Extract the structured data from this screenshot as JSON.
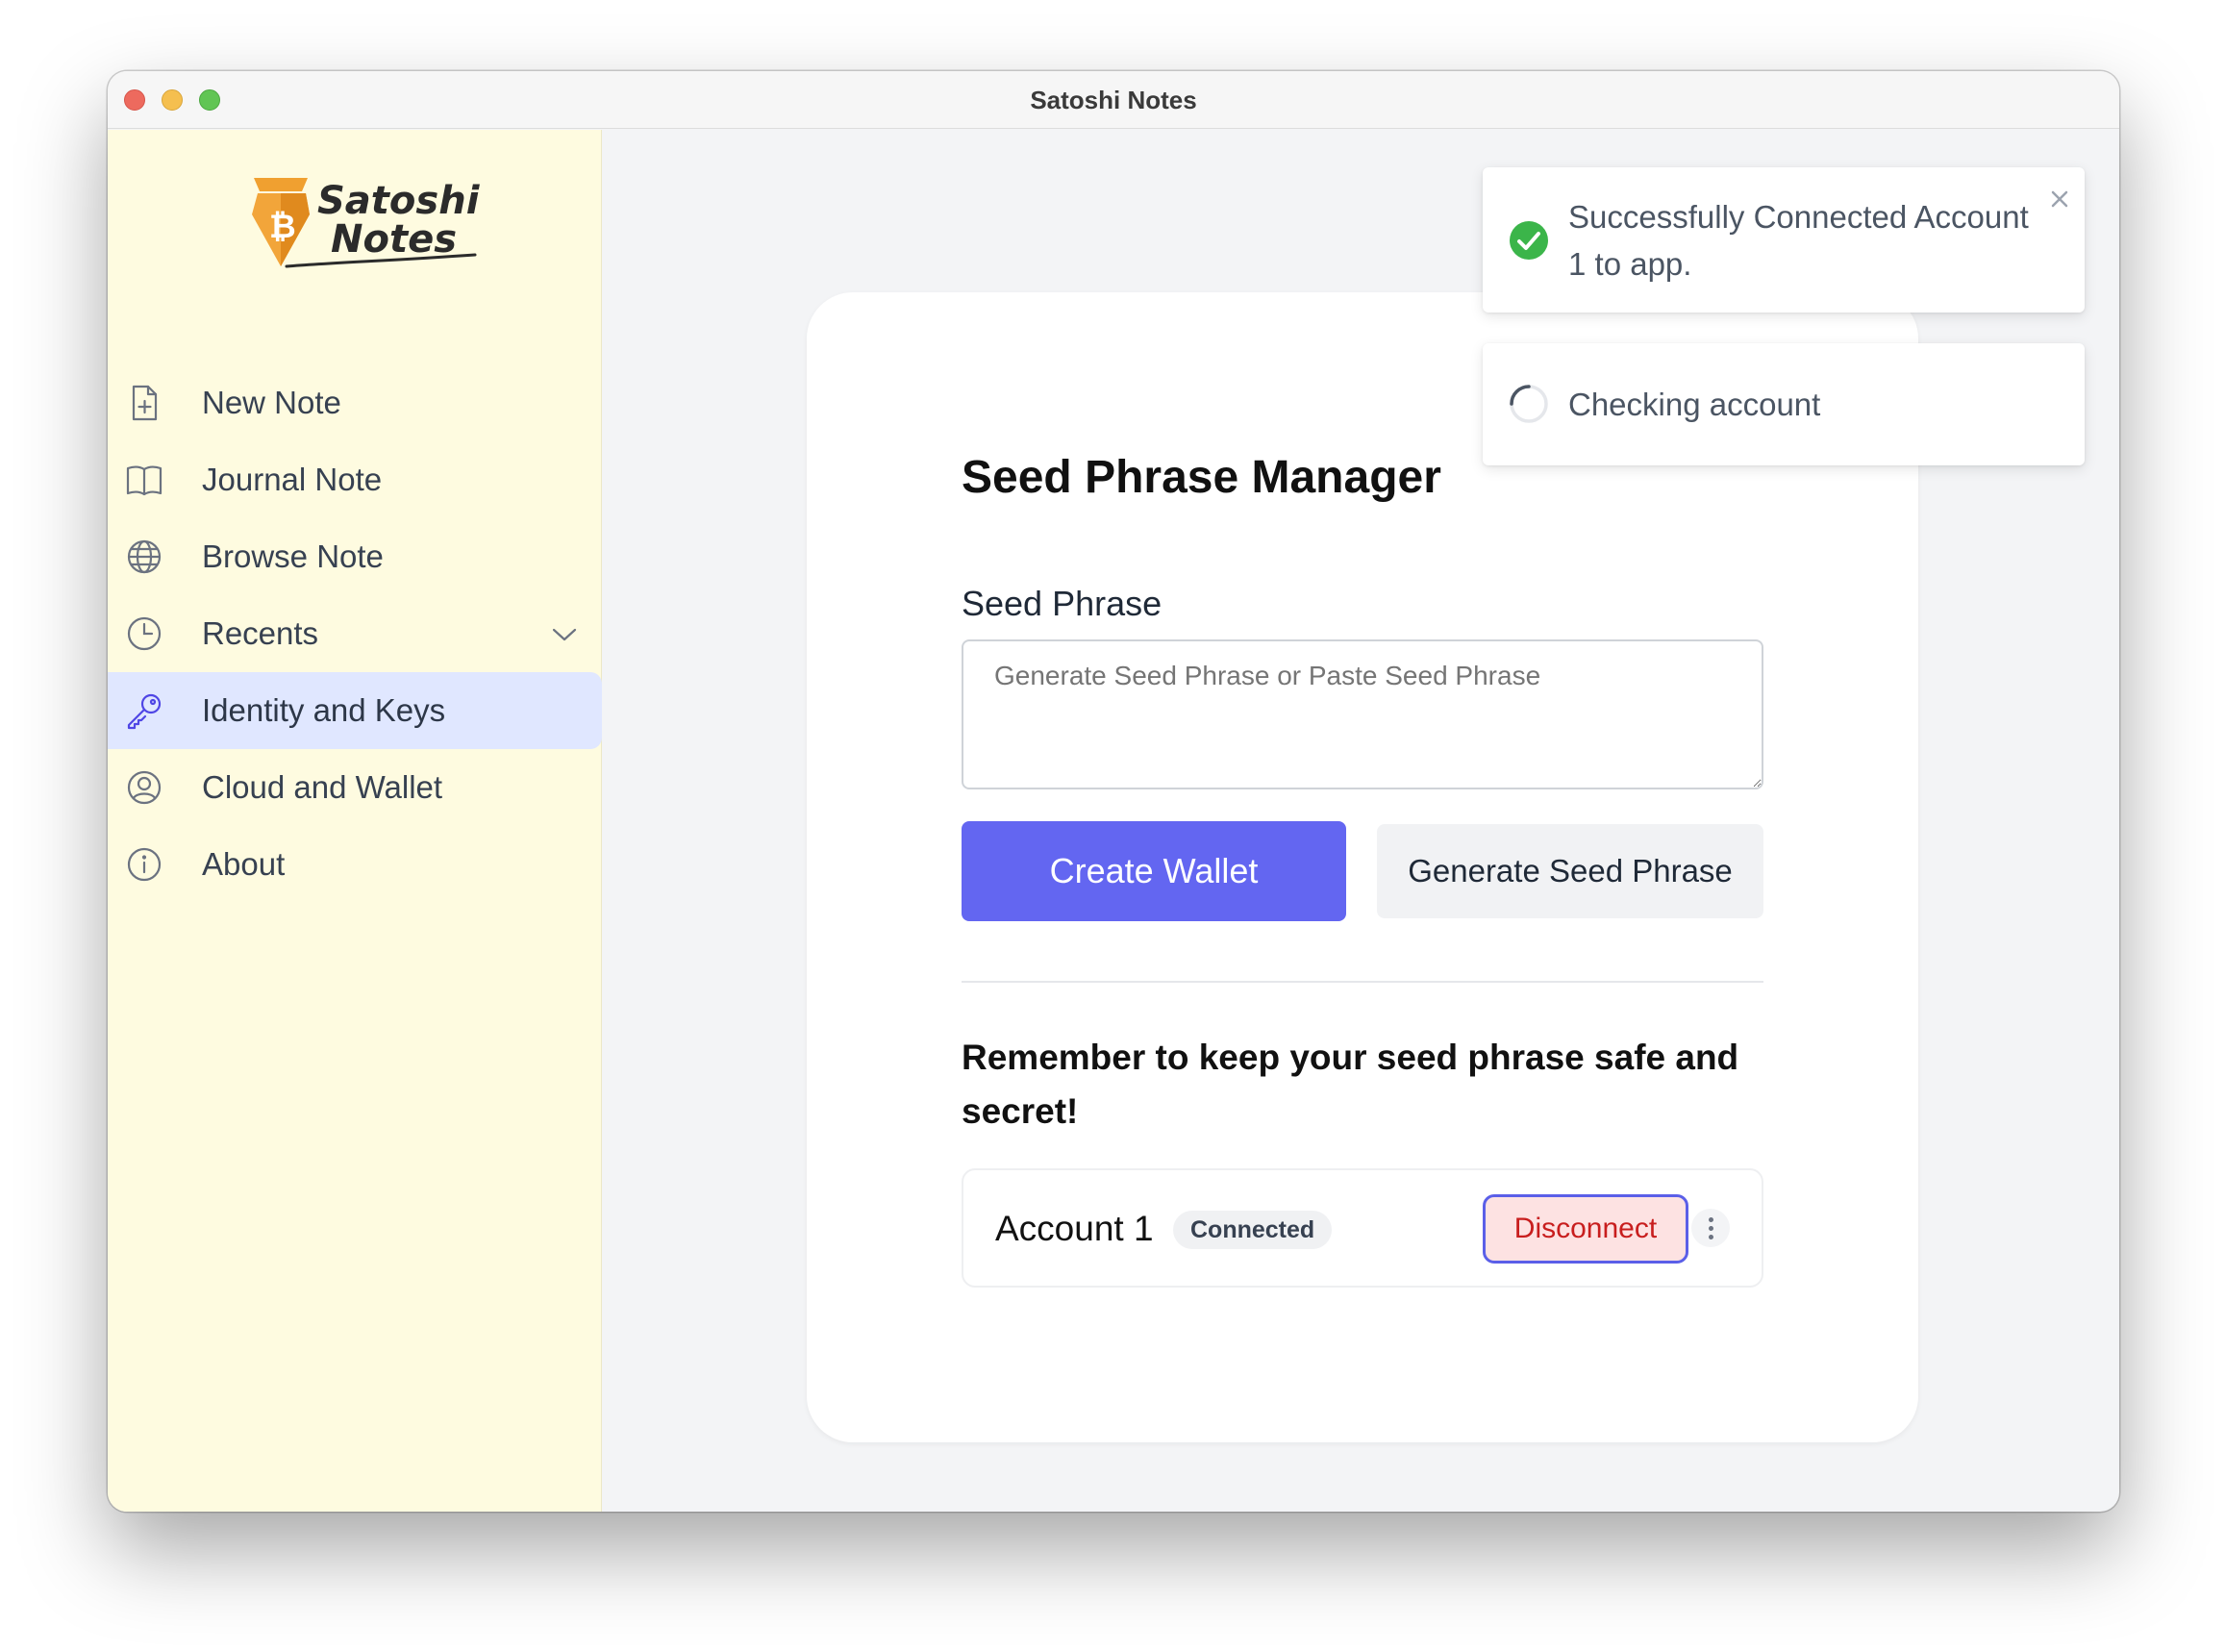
{
  "window": {
    "title": "Satoshi Notes"
  },
  "logo": {
    "line1": "Satoshi",
    "line2": "Notes"
  },
  "sidebar": {
    "items": [
      {
        "label": "New Note",
        "icon": "document-plus-icon"
      },
      {
        "label": "Journal Note",
        "icon": "book-open-icon"
      },
      {
        "label": "Browse Note",
        "icon": "globe-icon"
      },
      {
        "label": "Recents",
        "icon": "clock-icon",
        "expandable": true
      },
      {
        "label": "Identity and Keys",
        "icon": "key-icon",
        "active": true
      },
      {
        "label": "Cloud and Wallet",
        "icon": "user-circle-icon"
      },
      {
        "label": "About",
        "icon": "info-circle-icon"
      }
    ]
  },
  "main": {
    "title": "Seed Phrase Manager",
    "seed_label": "Seed Phrase",
    "seed_placeholder": "Generate Seed Phrase or Paste Seed Phrase",
    "seed_value": "",
    "create_label": "Create Wallet",
    "generate_label": "Generate Seed Phrase",
    "warning": "Remember to keep your seed phrase safe and secret!",
    "account": {
      "name": "Account 1",
      "status": "Connected",
      "disconnect_label": "Disconnect"
    }
  },
  "toasts": [
    {
      "type": "success",
      "message": "Successfully Connected Account 1 to app.",
      "closable": true
    },
    {
      "type": "loading",
      "message": "Checking account"
    }
  ],
  "colors": {
    "sidebar_bg": "#fefbe0",
    "accent": "#6366f1",
    "active_nav_bg": "#e0e7ff",
    "danger_text": "#c81e1e",
    "danger_bg": "#fde2e2",
    "success": "#3bb54a"
  }
}
